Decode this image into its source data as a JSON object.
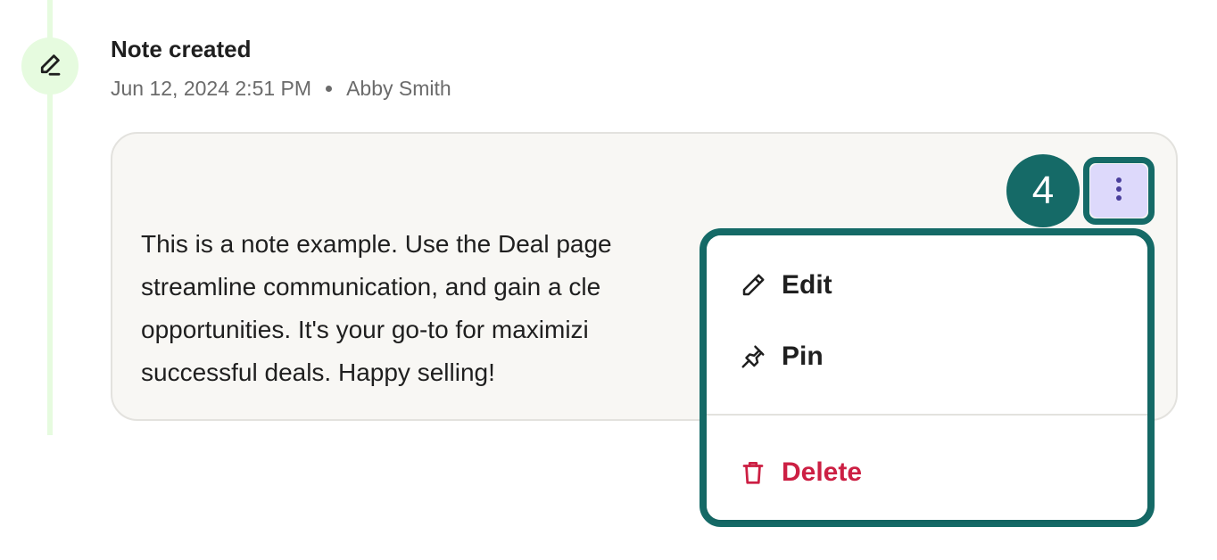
{
  "event": {
    "title": "Note created",
    "date": "Jun 12, 2024 2:51 PM",
    "author": "Abby Smith",
    "icon": "pen-icon"
  },
  "note": {
    "text": "This is a note example. Use the Deal page\nstreamline communication, and gain a cle\nopportunities. It's your go-to for maximizi\nsuccessful deals. Happy selling!"
  },
  "step_badge": "4",
  "more_button": {
    "icon": "kebab-vertical-icon"
  },
  "menu": {
    "items": [
      {
        "label": "Edit",
        "icon": "pencil-icon"
      },
      {
        "label": "Pin",
        "icon": "pin-icon"
      },
      {
        "label": "Delete",
        "icon": "trash-icon"
      }
    ]
  },
  "colors": {
    "accent": "#156a67",
    "timeline": "#e6fbdf",
    "danger": "#cc1f43",
    "kebab_bg": "#ddd9fb",
    "card_bg": "#f8f7f4"
  }
}
